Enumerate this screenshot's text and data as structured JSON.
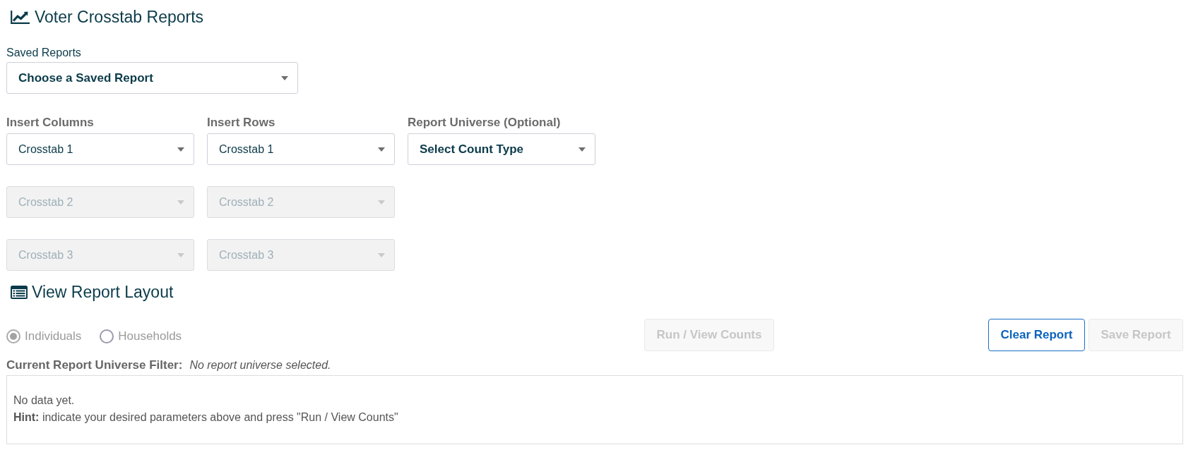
{
  "page_title": "Voter Crosstab Reports",
  "saved_reports": {
    "label": "Saved Reports",
    "placeholder": "Choose a Saved Report"
  },
  "crosstab_groups": [
    {
      "label": "Insert Columns",
      "selects": [
        {
          "value": "Crosstab 1",
          "disabled": false
        },
        {
          "value": "Crosstab 2",
          "disabled": true
        },
        {
          "value": "Crosstab 3",
          "disabled": true
        }
      ]
    },
    {
      "label": "Insert Rows",
      "selects": [
        {
          "value": "Crosstab 1",
          "disabled": false
        },
        {
          "value": "Crosstab 2",
          "disabled": true
        },
        {
          "value": "Crosstab 3",
          "disabled": true
        }
      ]
    }
  ],
  "report_universe": {
    "label": "Report Universe (Optional)",
    "placeholder": "Select Count Type"
  },
  "layout_section": {
    "title": "View Report Layout"
  },
  "count_options": [
    {
      "label": "Individuals",
      "selected": true
    },
    {
      "label": "Households",
      "selected": false
    }
  ],
  "run_button": {
    "label": "Run / View Counts",
    "disabled": true
  },
  "report_actions": [
    {
      "label": "Clear Report",
      "disabled": false
    },
    {
      "label": "Save Report",
      "disabled": true
    }
  ],
  "filter": {
    "label": "Current Report Universe Filter:",
    "value": "No report universe selected."
  },
  "results": {
    "message": "No data yet.",
    "hint": "**Hint:** indicate your desired parameters above and press \"Run / View Counts\""
  }
}
